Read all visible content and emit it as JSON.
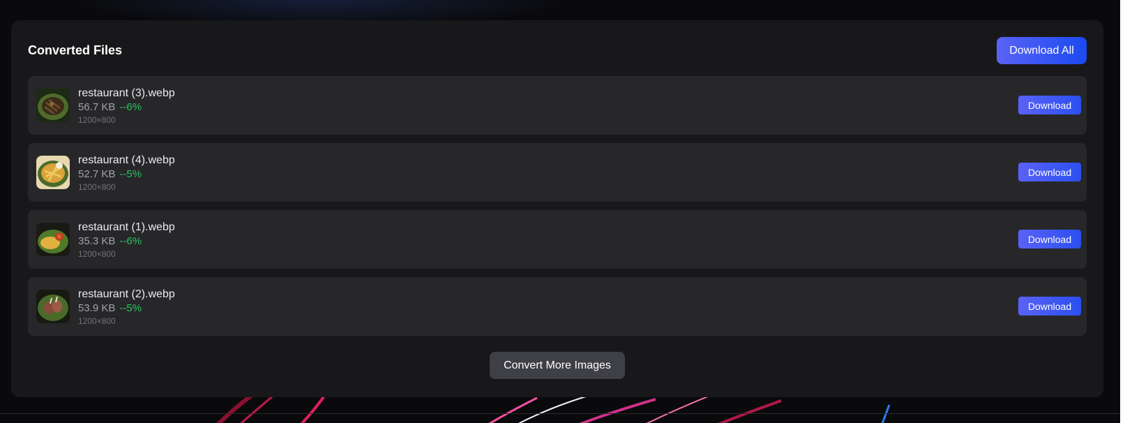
{
  "panel": {
    "title": "Converted Files",
    "download_all_label": "Download All",
    "convert_more_label": "Convert More Images"
  },
  "files": [
    {
      "name": "restaurant (3).webp",
      "size": "56.7 KB",
      "change": "--6%",
      "dimensions": "1200×800",
      "download_label": "Download",
      "thumbnail": "grilled-meat-dish"
    },
    {
      "name": "restaurant (4).webp",
      "size": "52.7 KB",
      "change": "--5%",
      "dimensions": "1200×800",
      "download_label": "Download",
      "thumbnail": "fries-plate"
    },
    {
      "name": "restaurant (1).webp",
      "size": "35.3 KB",
      "change": "--6%",
      "dimensions": "1200×800",
      "download_label": "Download",
      "thumbnail": "omelette-with-sauce"
    },
    {
      "name": "restaurant (2).webp",
      "size": "53.9 KB",
      "change": "--5%",
      "dimensions": "1200×800",
      "download_label": "Download",
      "thumbnail": "roasted-chicken-plate"
    }
  ],
  "colors": {
    "panel_bg": "#18181b",
    "row_bg": "#27272a",
    "accent_start": "#5a62f5",
    "accent_end": "#1a4af0",
    "positive": "#22c55e",
    "secondary_button": "#3f3f46"
  }
}
